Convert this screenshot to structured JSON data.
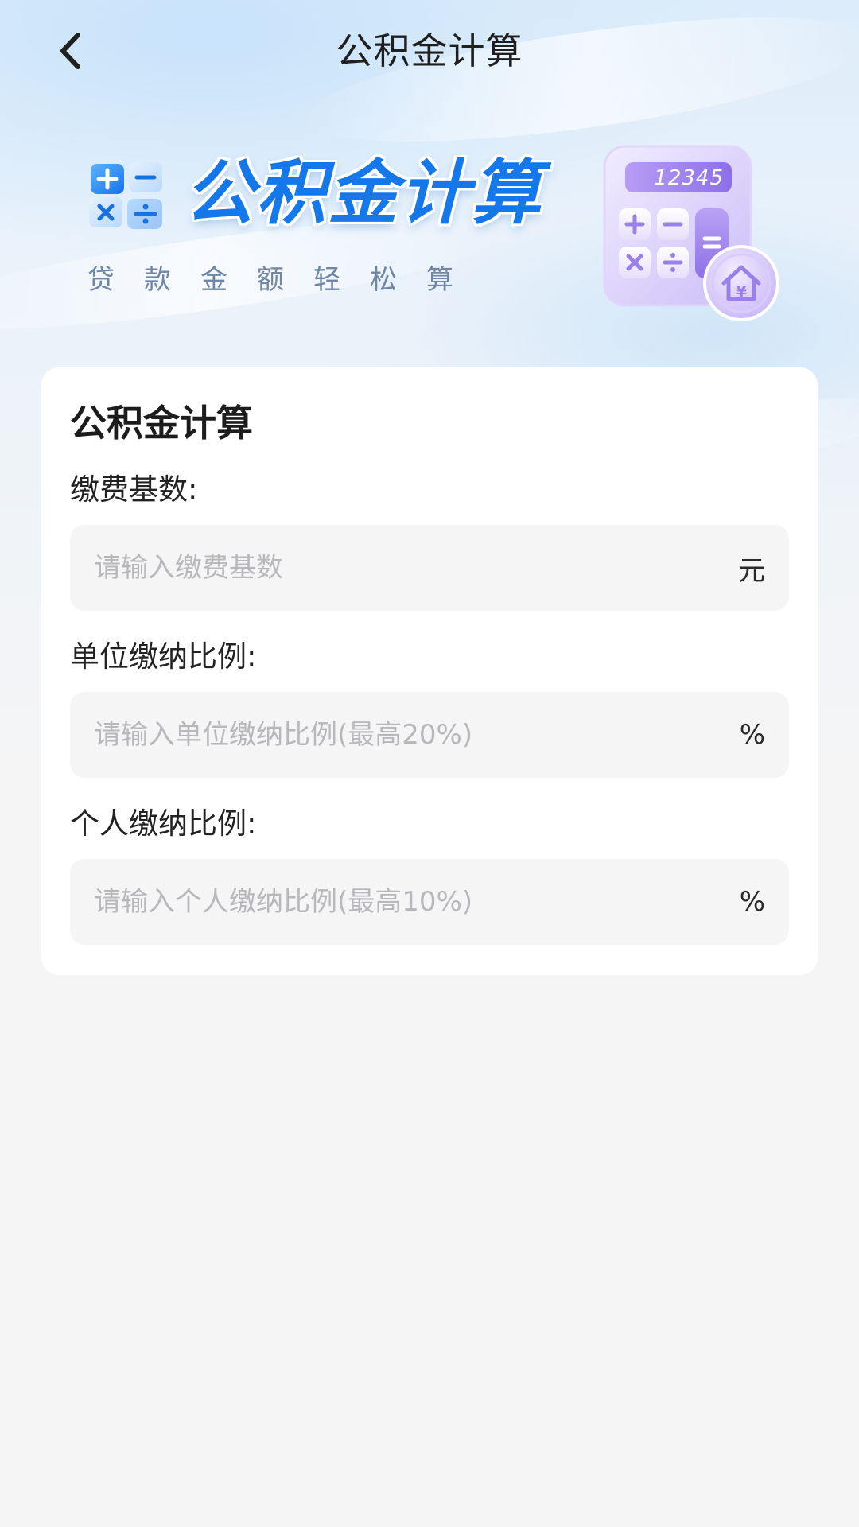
{
  "header": {
    "title": "公积金计算",
    "back_icon": "chevron-left-icon"
  },
  "banner": {
    "title": "公积金计算",
    "subtitle": "贷款金额轻松算",
    "ops_icon": "math-operators-icon",
    "calculator_display": "12345",
    "calculator_keys": [
      "+",
      "−",
      "×",
      "÷",
      "="
    ],
    "house_badge_symbol": "¥",
    "colors": {
      "title_blue": "#1578ea",
      "calculator_purple": "#a88cf0"
    }
  },
  "form": {
    "title": "公积金计算",
    "fields": [
      {
        "label": "缴费基数:",
        "placeholder": "请输入缴费基数",
        "value": "",
        "unit": "元"
      },
      {
        "label": "单位缴纳比例:",
        "placeholder": "请输入单位缴纳比例(最高20%)",
        "value": "",
        "unit": "%"
      },
      {
        "label": "个人缴纳比例:",
        "placeholder": "请输入个人缴纳比例(最高10%)",
        "value": "",
        "unit": "%"
      }
    ]
  }
}
